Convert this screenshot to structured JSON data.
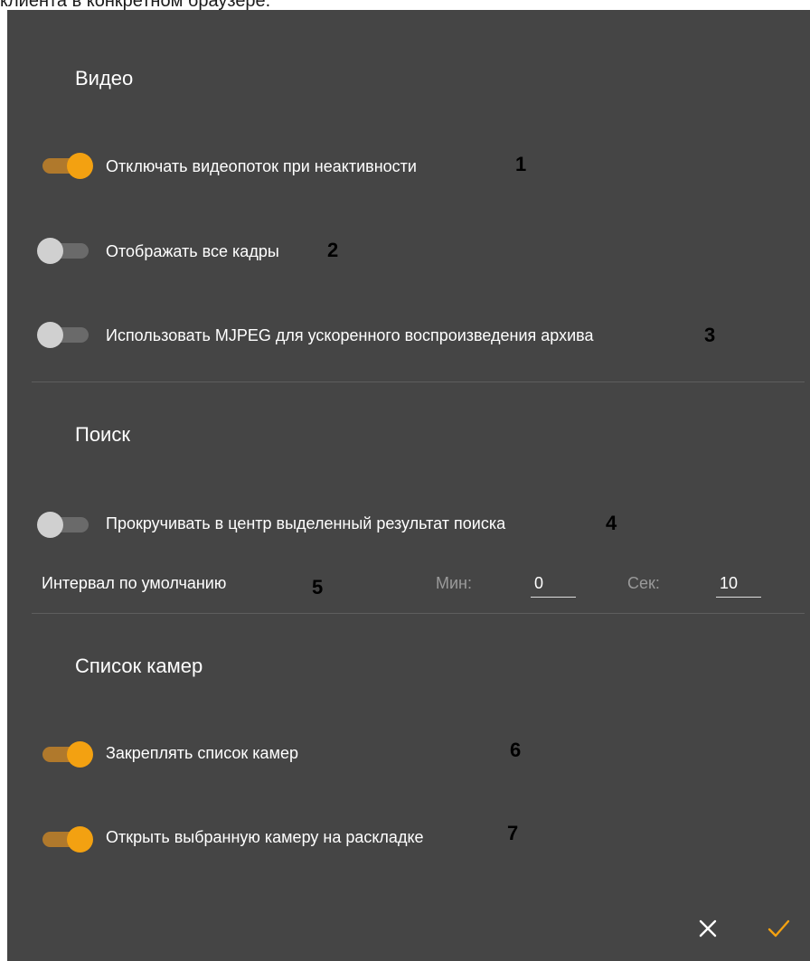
{
  "caption": "клиента в конкретном браузере.",
  "sections": {
    "video": {
      "title": "Видео",
      "items": [
        {
          "label": "Отключать видеопоток при неактивности",
          "enabled": true,
          "marker": "1"
        },
        {
          "label": "Отображать все кадры",
          "enabled": false,
          "marker": "2"
        },
        {
          "label": "Использовать MJPEG для ускоренного воспроизведения архива",
          "enabled": false,
          "marker": "3"
        }
      ]
    },
    "search": {
      "title": "Поиск",
      "scroll": {
        "label": "Прокручивать в центр выделенный результат поиска",
        "enabled": false,
        "marker": "4"
      },
      "interval": {
        "label": "Интервал по умолчанию",
        "marker": "5",
        "min_label": "Мин:",
        "min_value": "0",
        "sec_label": "Сек:",
        "sec_value": "10"
      }
    },
    "cameras": {
      "title": "Список камер",
      "items": [
        {
          "label": "Закреплять список камер",
          "enabled": true,
          "marker": "6"
        },
        {
          "label": "Открыть выбранную камеру на раскладке",
          "enabled": true,
          "marker": "7"
        }
      ]
    }
  },
  "actions": {
    "cancel_icon": "close-icon",
    "confirm_icon": "check-icon"
  },
  "colors": {
    "panel_bg": "#454545",
    "accent": "#f3a111",
    "accent_track": "#b0792c",
    "toggle_off_knob": "#d0d0d0",
    "toggle_off_track": "#6a6a6a"
  }
}
